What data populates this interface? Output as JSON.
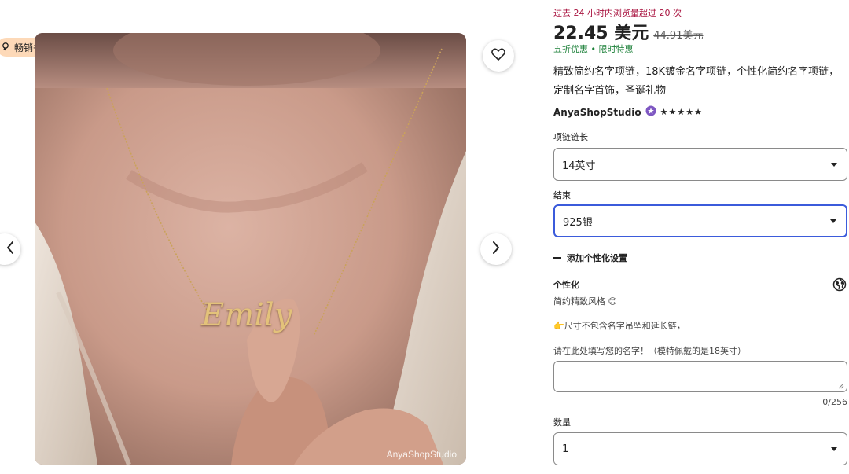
{
  "badge": {
    "label": "畅销书",
    "icon": "bestseller-icon"
  },
  "gallery": {
    "watermark": "AnyaShopStudio",
    "engraving": "Emily",
    "prev_icon": "chevron-left-icon",
    "next_icon": "chevron-right-icon",
    "favorite_icon": "heart-icon"
  },
  "product": {
    "views_note": "过去 24 小时内浏览量超过 20 次",
    "price": "22.45 美元",
    "original_price": "44.91美元",
    "sale_note": "五折优惠 • 限时特惠",
    "title": "精致简约名字项链，18K镀金名字项链，个性化简约名字项链，定制名字首饰，圣诞礼物",
    "shop_name": "AnyaShopStudio",
    "rating_stars": "★★★★★",
    "rating": 5
  },
  "options": {
    "length": {
      "label": "项链链长",
      "value": "14英寸"
    },
    "finish": {
      "label": "结束",
      "value": "925银"
    },
    "add_personalization": "添加个性化设置",
    "personalization": {
      "label": "个性化",
      "style_note": "简约精致风格 😊",
      "size_note": "👉尺寸不包含名字吊坠和延长链，",
      "instruction": "请在此处填写您的名字！（模特佩戴的是18英寸）",
      "counter": "0/256"
    },
    "quantity": {
      "label": "数量",
      "value": "1"
    }
  },
  "colors": {
    "accent": "#3b5bdb",
    "views": "#a8123e",
    "sale": "#1a7f37",
    "badge": "#fdd9b8"
  }
}
